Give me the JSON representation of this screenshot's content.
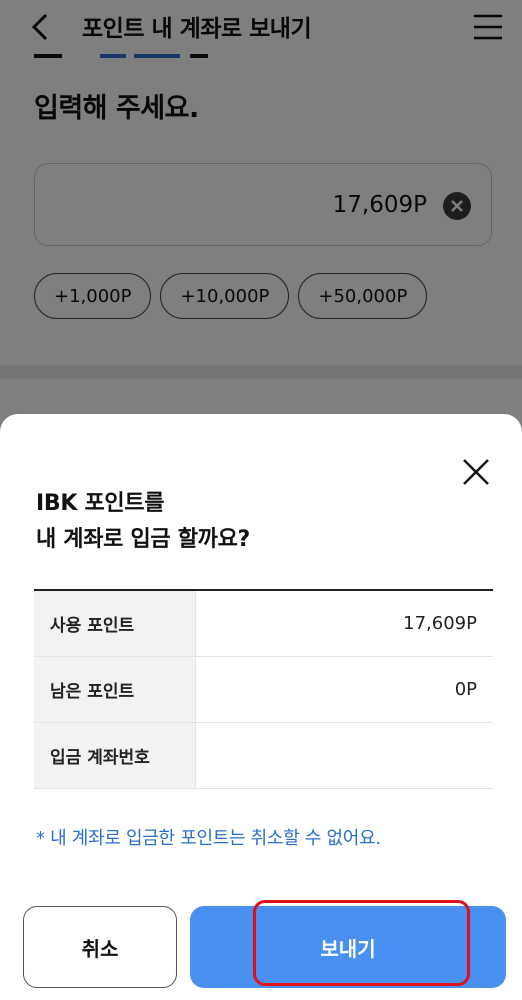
{
  "header": {
    "title": "포인트 내 계좌로 보내기",
    "back_icon": "chevron-left-icon",
    "menu_icon": "hamburger-menu-icon"
  },
  "main": {
    "prompt": "입력해 주세요.",
    "amount_value": "17,609P",
    "clear_icon": "clear-circle-icon",
    "chips": [
      {
        "label": "+1,000P"
      },
      {
        "label": "+10,000P"
      },
      {
        "label": "+50,000P"
      }
    ]
  },
  "sheet": {
    "close_icon": "close-icon",
    "title_line1": "IBK 포인트를",
    "title_line2": "내 계좌로 입금 할까요?",
    "rows": [
      {
        "label": "사용 포인트",
        "value": "17,609P"
      },
      {
        "label": "남은 포인트",
        "value": "0P"
      },
      {
        "label": "입금 계좌번호",
        "value": ""
      }
    ],
    "notice": "* 내 계좌로 입금한 포인트는 취소할 수 없어요.",
    "cancel_label": "취소",
    "send_label": "보내기"
  },
  "colors": {
    "accent_blue": "#4a90f0",
    "notice_blue": "#2a6fcf",
    "highlight_red": "#e0101a",
    "overlay": "rgba(0,0,0,0.5)"
  }
}
